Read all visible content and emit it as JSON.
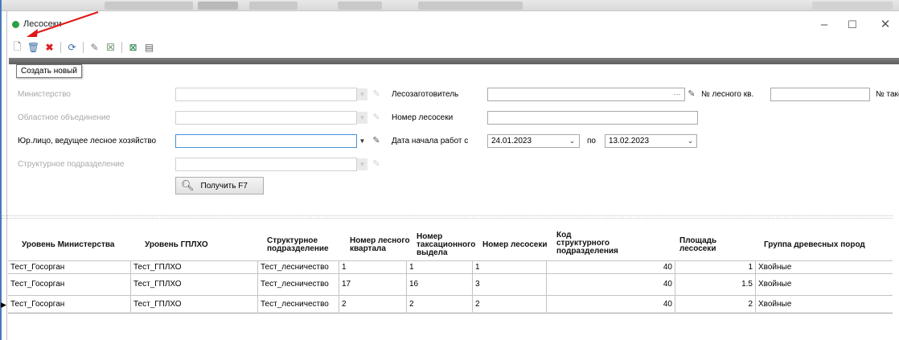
{
  "window": {
    "title": "Лесосеки"
  },
  "tooltip": {
    "text": "Создать новый"
  },
  "filters": {
    "ministry_label": "Министерство",
    "regional_label": "Областное объединение",
    "legal_label": "Юр.лицо, ведущее лесное хозяйство",
    "subdivision_label": "Структурное подразделение",
    "logger_label": "Лесозаготовитель",
    "cutting_number_label": "Номер лесосеки",
    "start_date_label": "Дата начала работ с",
    "start_date_value": "24.01.2023",
    "to_label": "по",
    "end_date_value": "13.02.2023",
    "forest_quarter_label": "№ лесного кв.",
    "taxation_label": "№ такс."
  },
  "get_button": {
    "label": "Получить F7"
  },
  "grid": {
    "headers": [
      "Уровень Министерства",
      "Уровень ГПЛХО",
      "Структурное подразделение",
      "Номер лесного квартала",
      "Номер таксационного выдела",
      "Номер лесосеки",
      "Код структурного подразделения",
      "Площадь лесосеки",
      "Группа древесных пород"
    ],
    "rows": [
      [
        "Тест_Госорган",
        "Тест_ГПЛХО",
        "Тест_лесничество",
        "1",
        "1",
        "1",
        "40",
        "1",
        "Хвойные"
      ],
      [
        "Тест_Госорган",
        "Тест_ГПЛХО",
        "Тест_лесничество",
        "17",
        "16",
        "3",
        "40",
        "1.5",
        "Хвойные"
      ],
      [
        "Тест_Госорган",
        "Тест_ГПЛХО",
        "Тест_лесничество",
        "2",
        "2",
        "2",
        "40",
        "2",
        "Хвойные"
      ]
    ]
  }
}
